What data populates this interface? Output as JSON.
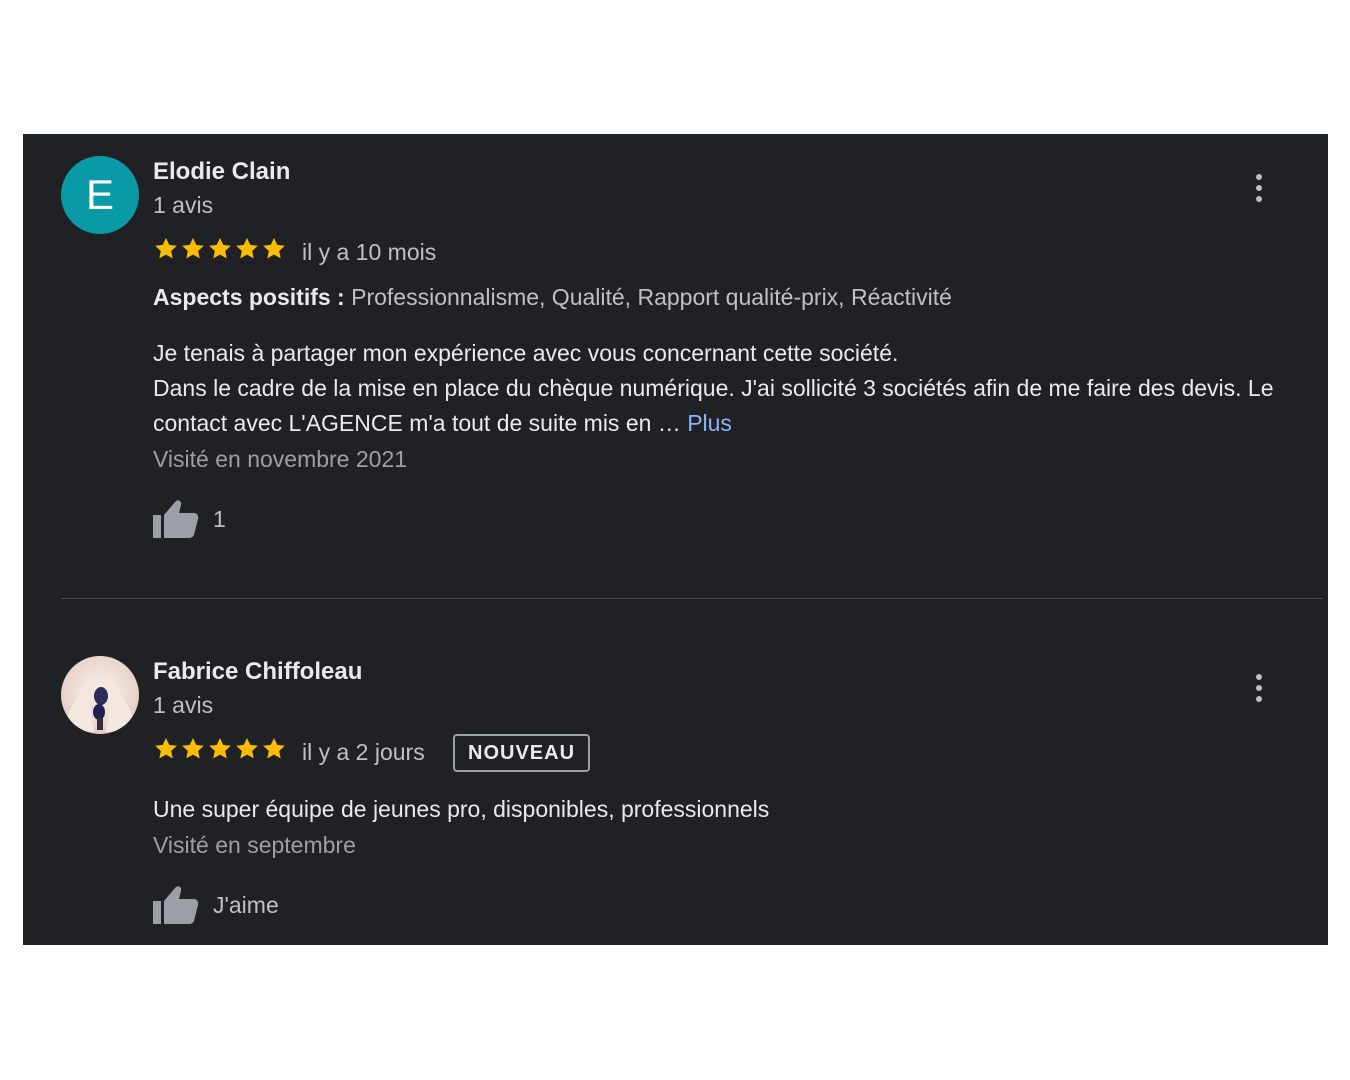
{
  "colors": {
    "panel_bg": "#202124",
    "star": "#fbbc04",
    "link": "#8ab4f8",
    "avatar_bg": "#0a9aa6"
  },
  "reviews": [
    {
      "avatar_letter": "E",
      "name": "Elodie Clain",
      "count": "1 avis",
      "rating": 5,
      "date": "il y a 10 mois",
      "aspects_label": "Aspects positifs :",
      "aspects_value": "Professionnalisme, Qualité, Rapport qualité-prix, Réactivité",
      "text_line1": "Je tenais à partager mon expérience avec vous concernant cette société.",
      "text_line2": "Dans le cadre de la mise en place du chèque numérique. J'ai sollicité 3 sociétés afin de me faire des devis. Le contact avec L'AGENCE m'a tout de suite mis en …",
      "more_label": "Plus",
      "visited": "Visité en novembre 2021",
      "like_label": "1",
      "icons": [
        "thumbs-up-icon",
        "more-vert-icon",
        "star-icon"
      ]
    },
    {
      "avatar": "user-photo",
      "name": "Fabrice Chiffoleau",
      "count": "1 avis",
      "rating": 5,
      "date": "il y a 2 jours",
      "badge": "NOUVEAU",
      "text": "Une super équipe de jeunes pro, disponibles, professionnels",
      "visited": "Visité en septembre",
      "like_label": "J'aime",
      "icons": [
        "thumbs-up-icon",
        "more-vert-icon",
        "star-icon"
      ]
    }
  ]
}
